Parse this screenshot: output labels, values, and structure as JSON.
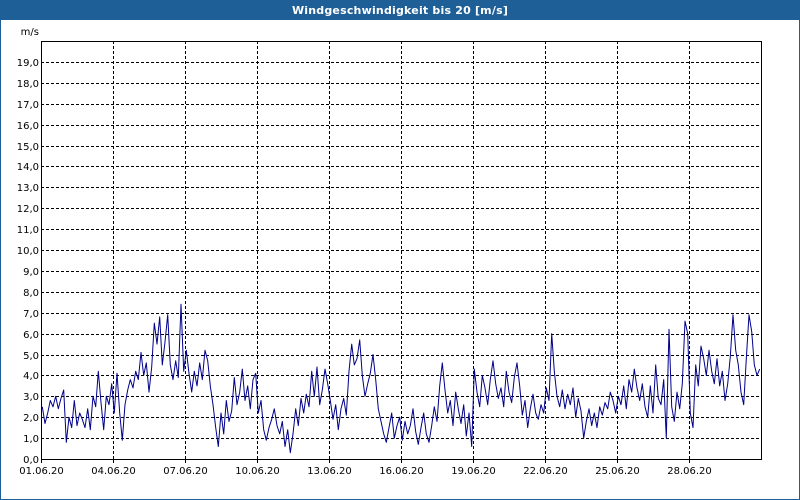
{
  "window": {
    "title": "Windgeschwindigkeit bis 20 [m/s]"
  },
  "colors": {
    "titlebar": "#1f5f98",
    "series": "#00008b",
    "grid": "#000000"
  },
  "chart_data": {
    "type": "line",
    "title": "Windgeschwindigkeit bis 20 [m/s]",
    "ylabel": "m/s",
    "xlabel": "",
    "ylim": [
      0,
      20
    ],
    "y_ticks": [
      "0,0",
      "1,0",
      "2,0",
      "3,0",
      "4,0",
      "5,0",
      "6,0",
      "7,0",
      "8,0",
      "9,0",
      "10,0",
      "11,0",
      "12,0",
      "13,0",
      "14,0",
      "15,0",
      "16,0",
      "17,0",
      "18,0",
      "19,0"
    ],
    "x_range": [
      "2020-06-01",
      "2020-07-01"
    ],
    "x_ticks": [
      "01.06.20",
      "04.06.20",
      "07.06.20",
      "10.06.20",
      "13.06.20",
      "16.06.20",
      "19.06.20",
      "22.06.20",
      "25.06.20",
      "28.06.20"
    ],
    "grid": true,
    "series": [
      {
        "values": [
          [
            "2020-06-01",
            2.5
          ],
          [
            "2020-06-01",
            1.7
          ],
          [
            "2020-06-01",
            2.2
          ],
          [
            "2020-06-01",
            2.8
          ],
          [
            "2020-06-01",
            2.5
          ],
          [
            "2020-06-01",
            3.0
          ],
          [
            "2020-06-01",
            2.4
          ],
          [
            "2020-06-01",
            2.9
          ],
          [
            "2020-06-01",
            3.3
          ],
          [
            "2020-06-02",
            0.8
          ],
          [
            "2020-06-02",
            2.0
          ],
          [
            "2020-06-02",
            1.5
          ],
          [
            "2020-06-02",
            2.8
          ],
          [
            "2020-06-02",
            1.6
          ],
          [
            "2020-06-02",
            2.2
          ],
          [
            "2020-06-02",
            1.9
          ],
          [
            "2020-06-02",
            1.5
          ],
          [
            "2020-06-02",
            2.4
          ],
          [
            "2020-06-03",
            1.4
          ],
          [
            "2020-06-03",
            3.0
          ],
          [
            "2020-06-03",
            2.5
          ],
          [
            "2020-06-03",
            4.2
          ],
          [
            "2020-06-03",
            2.7
          ],
          [
            "2020-06-03",
            1.4
          ],
          [
            "2020-06-03",
            3.0
          ],
          [
            "2020-06-03",
            2.6
          ],
          [
            "2020-06-03",
            3.6
          ],
          [
            "2020-06-04",
            2.2
          ],
          [
            "2020-06-04",
            4.1
          ],
          [
            "2020-06-04",
            2.2
          ],
          [
            "2020-06-04",
            0.9
          ],
          [
            "2020-06-04",
            2.6
          ],
          [
            "2020-06-04",
            3.3
          ],
          [
            "2020-06-04",
            3.8
          ],
          [
            "2020-06-04",
            3.4
          ],
          [
            "2020-06-04",
            4.2
          ],
          [
            "2020-06-05",
            3.8
          ],
          [
            "2020-06-05",
            5.1
          ],
          [
            "2020-06-05",
            4.0
          ],
          [
            "2020-06-05",
            4.6
          ],
          [
            "2020-06-05",
            3.2
          ],
          [
            "2020-06-05",
            4.4
          ],
          [
            "2020-06-05",
            6.5
          ],
          [
            "2020-06-05",
            5.5
          ],
          [
            "2020-06-05",
            6.8
          ],
          [
            "2020-06-06",
            4.5
          ],
          [
            "2020-06-06",
            5.6
          ],
          [
            "2020-06-06",
            6.9
          ],
          [
            "2020-06-06",
            4.5
          ],
          [
            "2020-06-06",
            3.8
          ],
          [
            "2020-06-06",
            4.7
          ],
          [
            "2020-06-06",
            3.9
          ],
          [
            "2020-06-06",
            7.4
          ],
          [
            "2020-06-06",
            4.2
          ],
          [
            "2020-06-07",
            5.2
          ],
          [
            "2020-06-07",
            4.1
          ],
          [
            "2020-06-07",
            3.2
          ],
          [
            "2020-06-07",
            4.2
          ],
          [
            "2020-06-07",
            3.5
          ],
          [
            "2020-06-07",
            4.6
          ],
          [
            "2020-06-07",
            3.8
          ],
          [
            "2020-06-07",
            5.2
          ],
          [
            "2020-06-07",
            4.7
          ],
          [
            "2020-06-08",
            3.5
          ],
          [
            "2020-06-08",
            2.6
          ],
          [
            "2020-06-08",
            1.5
          ],
          [
            "2020-06-08",
            0.6
          ],
          [
            "2020-06-08",
            2.2
          ],
          [
            "2020-06-08",
            1.2
          ],
          [
            "2020-06-08",
            2.8
          ],
          [
            "2020-06-08",
            1.8
          ],
          [
            "2020-06-08",
            2.3
          ],
          [
            "2020-06-09",
            3.9
          ],
          [
            "2020-06-09",
            2.6
          ],
          [
            "2020-06-09",
            3.2
          ],
          [
            "2020-06-09",
            4.3
          ],
          [
            "2020-06-09",
            2.8
          ],
          [
            "2020-06-09",
            3.5
          ],
          [
            "2020-06-09",
            2.4
          ],
          [
            "2020-06-09",
            3.8
          ],
          [
            "2020-06-09",
            4.1
          ],
          [
            "2020-06-10",
            2.2
          ],
          [
            "2020-06-10",
            2.8
          ],
          [
            "2020-06-10",
            1.4
          ],
          [
            "2020-06-10",
            0.9
          ],
          [
            "2020-06-10",
            1.5
          ],
          [
            "2020-06-10",
            1.9
          ],
          [
            "2020-06-10",
            2.4
          ],
          [
            "2020-06-10",
            1.6
          ],
          [
            "2020-06-10",
            1.2
          ],
          [
            "2020-06-11",
            1.8
          ],
          [
            "2020-06-11",
            0.6
          ],
          [
            "2020-06-11",
            1.4
          ],
          [
            "2020-06-11",
            0.3
          ],
          [
            "2020-06-11",
            1.2
          ],
          [
            "2020-06-11",
            2.4
          ],
          [
            "2020-06-11",
            1.6
          ],
          [
            "2020-06-11",
            2.9
          ],
          [
            "2020-06-11",
            2.2
          ],
          [
            "2020-06-12",
            3.1
          ],
          [
            "2020-06-12",
            2.5
          ],
          [
            "2020-06-12",
            4.2
          ],
          [
            "2020-06-12",
            3.0
          ],
          [
            "2020-06-12",
            4.4
          ],
          [
            "2020-06-12",
            2.6
          ],
          [
            "2020-06-12",
            3.3
          ],
          [
            "2020-06-12",
            4.3
          ],
          [
            "2020-06-12",
            3.6
          ],
          [
            "2020-06-13",
            2.8
          ],
          [
            "2020-06-13",
            1.9
          ],
          [
            "2020-06-13",
            2.6
          ],
          [
            "2020-06-13",
            1.4
          ],
          [
            "2020-06-13",
            2.4
          ],
          [
            "2020-06-13",
            2.9
          ],
          [
            "2020-06-13",
            2.1
          ],
          [
            "2020-06-13",
            4.2
          ],
          [
            "2020-06-13",
            5.5
          ],
          [
            "2020-06-14",
            4.5
          ],
          [
            "2020-06-14",
            4.8
          ],
          [
            "2020-06-14",
            5.7
          ],
          [
            "2020-06-14",
            4.0
          ],
          [
            "2020-06-14",
            3.0
          ],
          [
            "2020-06-14",
            3.6
          ],
          [
            "2020-06-14",
            4.1
          ],
          [
            "2020-06-14",
            5.0
          ],
          [
            "2020-06-14",
            3.8
          ],
          [
            "2020-06-15",
            2.4
          ],
          [
            "2020-06-15",
            1.8
          ],
          [
            "2020-06-15",
            1.2
          ],
          [
            "2020-06-15",
            0.8
          ],
          [
            "2020-06-15",
            1.5
          ],
          [
            "2020-06-15",
            2.2
          ],
          [
            "2020-06-15",
            1.0
          ],
          [
            "2020-06-15",
            1.6
          ],
          [
            "2020-06-15",
            2.0
          ],
          [
            "2020-06-16",
            0.9
          ],
          [
            "2020-06-16",
            1.8
          ],
          [
            "2020-06-16",
            1.2
          ],
          [
            "2020-06-16",
            1.6
          ],
          [
            "2020-06-16",
            2.4
          ],
          [
            "2020-06-16",
            1.3
          ],
          [
            "2020-06-16",
            0.7
          ],
          [
            "2020-06-16",
            1.5
          ],
          [
            "2020-06-16",
            2.2
          ],
          [
            "2020-06-17",
            1.2
          ],
          [
            "2020-06-17",
            0.8
          ],
          [
            "2020-06-17",
            1.6
          ],
          [
            "2020-06-17",
            2.5
          ],
          [
            "2020-06-17",
            1.8
          ],
          [
            "2020-06-17",
            3.5
          ],
          [
            "2020-06-17",
            4.6
          ],
          [
            "2020-06-17",
            3.3
          ],
          [
            "2020-06-17",
            2.2
          ],
          [
            "2020-06-18",
            2.8
          ],
          [
            "2020-06-18",
            1.6
          ],
          [
            "2020-06-18",
            3.2
          ],
          [
            "2020-06-18",
            2.4
          ],
          [
            "2020-06-18",
            1.7
          ],
          [
            "2020-06-18",
            2.6
          ],
          [
            "2020-06-18",
            1.1
          ],
          [
            "2020-06-18",
            2.2
          ],
          [
            "2020-06-18",
            0.6
          ],
          [
            "2020-06-19",
            4.3
          ],
          [
            "2020-06-19",
            3.2
          ],
          [
            "2020-06-19",
            2.5
          ],
          [
            "2020-06-19",
            4.0
          ],
          [
            "2020-06-19",
            3.4
          ],
          [
            "2020-06-19",
            2.6
          ],
          [
            "2020-06-19",
            3.8
          ],
          [
            "2020-06-19",
            4.7
          ],
          [
            "2020-06-19",
            3.6
          ],
          [
            "2020-06-20",
            2.9
          ],
          [
            "2020-06-20",
            3.4
          ],
          [
            "2020-06-20",
            2.5
          ],
          [
            "2020-06-20",
            4.2
          ],
          [
            "2020-06-20",
            3.2
          ],
          [
            "2020-06-20",
            2.7
          ],
          [
            "2020-06-20",
            3.9
          ],
          [
            "2020-06-20",
            4.6
          ],
          [
            "2020-06-20",
            3.5
          ],
          [
            "2020-06-21",
            2.1
          ],
          [
            "2020-06-21",
            2.8
          ],
          [
            "2020-06-21",
            1.5
          ],
          [
            "2020-06-21",
            2.4
          ],
          [
            "2020-06-21",
            3.1
          ],
          [
            "2020-06-21",
            2.2
          ],
          [
            "2020-06-21",
            1.9
          ],
          [
            "2020-06-21",
            2.6
          ],
          [
            "2020-06-21",
            2.2
          ],
          [
            "2020-06-22",
            3.4
          ],
          [
            "2020-06-22",
            2.8
          ],
          [
            "2020-06-22",
            6.0
          ],
          [
            "2020-06-22",
            4.2
          ],
          [
            "2020-06-22",
            3.0
          ],
          [
            "2020-06-22",
            2.5
          ],
          [
            "2020-06-22",
            3.3
          ],
          [
            "2020-06-22",
            2.4
          ],
          [
            "2020-06-22",
            3.1
          ],
          [
            "2020-06-23",
            2.6
          ],
          [
            "2020-06-23",
            3.4
          ],
          [
            "2020-06-23",
            2.0
          ],
          [
            "2020-06-23",
            2.9
          ],
          [
            "2020-06-23",
            2.3
          ],
          [
            "2020-06-23",
            1.0
          ],
          [
            "2020-06-23",
            1.8
          ],
          [
            "2020-06-23",
            2.4
          ],
          [
            "2020-06-23",
            1.6
          ],
          [
            "2020-06-24",
            2.2
          ],
          [
            "2020-06-24",
            1.5
          ],
          [
            "2020-06-24",
            2.5
          ],
          [
            "2020-06-24",
            2.1
          ],
          [
            "2020-06-24",
            2.7
          ],
          [
            "2020-06-24",
            2.4
          ],
          [
            "2020-06-24",
            3.2
          ],
          [
            "2020-06-24",
            2.8
          ],
          [
            "2020-06-24",
            2.2
          ],
          [
            "2020-06-25",
            3.0
          ],
          [
            "2020-06-25",
            2.6
          ],
          [
            "2020-06-25",
            3.5
          ],
          [
            "2020-06-25",
            2.4
          ],
          [
            "2020-06-25",
            3.8
          ],
          [
            "2020-06-25",
            3.2
          ],
          [
            "2020-06-25",
            4.3
          ],
          [
            "2020-06-25",
            3.4
          ],
          [
            "2020-06-25",
            2.8
          ],
          [
            "2020-06-26",
            3.6
          ],
          [
            "2020-06-26",
            2.5
          ],
          [
            "2020-06-26",
            2.0
          ],
          [
            "2020-06-26",
            3.5
          ],
          [
            "2020-06-26",
            2.2
          ],
          [
            "2020-06-26",
            4.5
          ],
          [
            "2020-06-26",
            2.9
          ],
          [
            "2020-06-26",
            2.6
          ],
          [
            "2020-06-26",
            3.8
          ],
          [
            "2020-06-27",
            1.0
          ],
          [
            "2020-06-27",
            6.2
          ],
          [
            "2020-06-27",
            2.5
          ],
          [
            "2020-06-27",
            1.8
          ],
          [
            "2020-06-27",
            3.2
          ],
          [
            "2020-06-27",
            2.4
          ],
          [
            "2020-06-27",
            3.6
          ],
          [
            "2020-06-27",
            6.6
          ],
          [
            "2020-06-27",
            6.0
          ],
          [
            "2020-06-28",
            2.2
          ],
          [
            "2020-06-28",
            1.5
          ],
          [
            "2020-06-28",
            4.5
          ],
          [
            "2020-06-28",
            3.5
          ],
          [
            "2020-06-28",
            5.4
          ],
          [
            "2020-06-28",
            4.8
          ],
          [
            "2020-06-28",
            4.0
          ],
          [
            "2020-06-28",
            5.2
          ],
          [
            "2020-06-28",
            4.2
          ],
          [
            "2020-06-29",
            3.6
          ],
          [
            "2020-06-29",
            4.8
          ],
          [
            "2020-06-29",
            3.5
          ],
          [
            "2020-06-29",
            4.2
          ],
          [
            "2020-06-29",
            2.8
          ],
          [
            "2020-06-29",
            3.6
          ],
          [
            "2020-06-29",
            4.9
          ],
          [
            "2020-06-29",
            6.9
          ],
          [
            "2020-06-29",
            5.2
          ],
          [
            "2020-06-30",
            4.5
          ],
          [
            "2020-06-30",
            3.2
          ],
          [
            "2020-06-30",
            2.6
          ],
          [
            "2020-06-30",
            4.8
          ],
          [
            "2020-06-30",
            6.9
          ],
          [
            "2020-06-30",
            6.1
          ],
          [
            "2020-06-30",
            4.5
          ],
          [
            "2020-06-30",
            4.0
          ],
          [
            "2020-06-30",
            4.3
          ]
        ]
      }
    ]
  }
}
